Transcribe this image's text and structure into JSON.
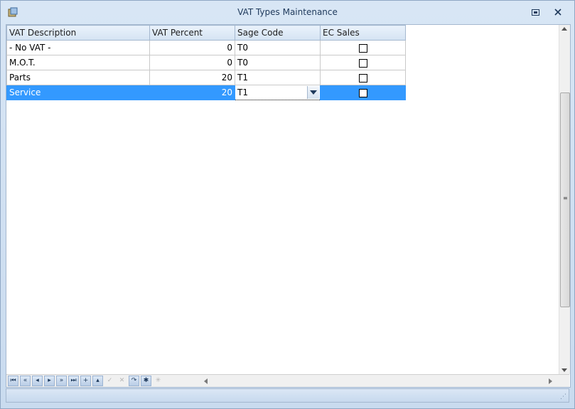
{
  "window": {
    "title": "VAT Types Maintenance"
  },
  "grid": {
    "columns": [
      "VAT Description",
      "VAT Percent",
      "Sage Code",
      "EC Sales"
    ],
    "rows": [
      {
        "description": "- No VAT -",
        "percent": "0",
        "sage_code": "T0",
        "ec_sales": false
      },
      {
        "description": "M.O.T.",
        "percent": "0",
        "sage_code": "T0",
        "ec_sales": false
      },
      {
        "description": "Parts",
        "percent": "20",
        "sage_code": "T1",
        "ec_sales": false
      },
      {
        "description": "Service",
        "percent": "20",
        "sage_code": "T1",
        "ec_sales": false
      }
    ],
    "selected_row": 3
  },
  "navigator": {
    "buttons": [
      {
        "name": "first-page",
        "glyph": "⏮",
        "enabled": true
      },
      {
        "name": "prior-page",
        "glyph": "«",
        "enabled": true
      },
      {
        "name": "prior-record",
        "glyph": "◂",
        "enabled": true
      },
      {
        "name": "next-record",
        "glyph": "▸",
        "enabled": true
      },
      {
        "name": "next-page",
        "glyph": "»",
        "enabled": true
      },
      {
        "name": "last-page",
        "glyph": "⏭",
        "enabled": true
      },
      {
        "name": "insert",
        "glyph": "+",
        "enabled": true
      },
      {
        "name": "delete",
        "glyph": "▴",
        "enabled": true
      },
      {
        "name": "post",
        "glyph": "✓",
        "enabled": false
      },
      {
        "name": "cancel",
        "glyph": "✕",
        "enabled": false
      },
      {
        "name": "refresh",
        "glyph": "↷",
        "enabled": true
      },
      {
        "name": "save-bookmark",
        "glyph": "✱",
        "enabled": true
      },
      {
        "name": "goto-bookmark",
        "glyph": "✳",
        "enabled": false
      }
    ]
  },
  "colors": {
    "selection": "#3399ff",
    "chrome": "#c9dbef"
  }
}
